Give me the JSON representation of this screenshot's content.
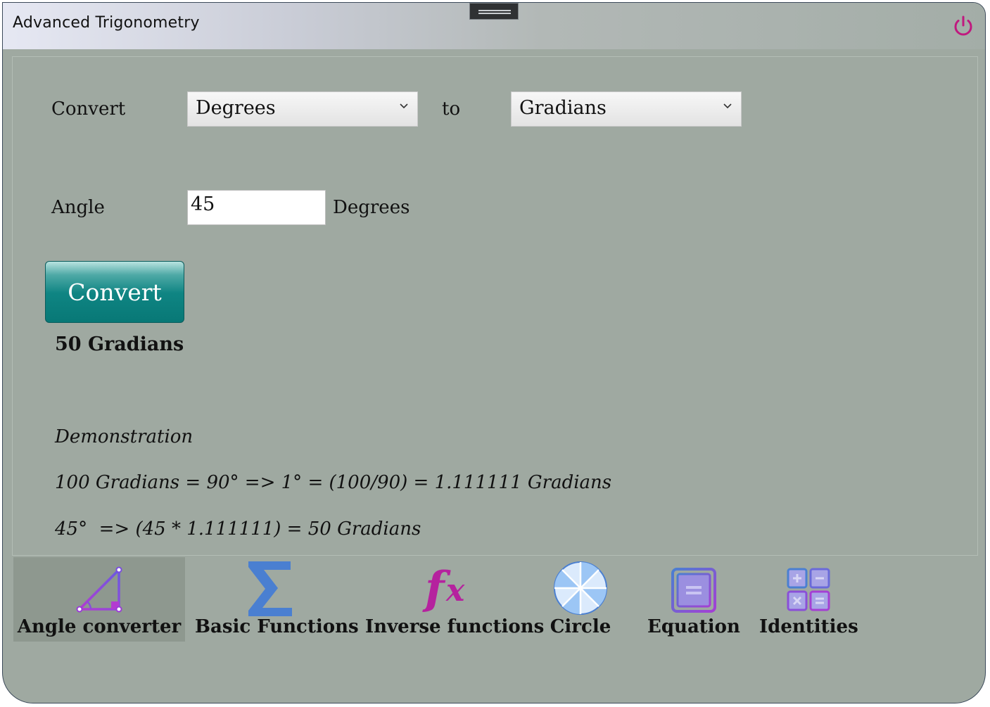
{
  "app": {
    "title": "Advanced Trigonometry"
  },
  "converter": {
    "convert_label": "Convert",
    "from_unit": "Degrees",
    "to_label": "to",
    "to_unit": "Gradians",
    "angle_label": "Angle",
    "angle_value": "45",
    "angle_unit": "Degrees",
    "convert_button": "Convert",
    "result": "50 Gradians"
  },
  "demonstration": {
    "heading": "Demonstration",
    "line1": "100 Gradians = 90° => 1° = (100/90) = 1.111111 Gradians",
    "line2": "45°  => (45 * 1.111111) = 50 Gradians"
  },
  "nav": [
    {
      "label": "Angle converter",
      "icon": "triangle-icon",
      "active": true
    },
    {
      "label": "Basic Functions",
      "icon": "sigma-icon"
    },
    {
      "label": "Inverse functions",
      "icon": "fx-icon"
    },
    {
      "label": "Circle",
      "icon": "circle-icon"
    },
    {
      "label": "Equation",
      "icon": "equation-icon"
    },
    {
      "label": "Identities",
      "icon": "calculator-icon"
    }
  ],
  "colors": {
    "background": "#9fa9a1",
    "button": "#0f8583",
    "power": "#c0197f",
    "icon_purple": "#8a3bd8",
    "icon_blue": "#4a7fd1",
    "icon_magenta": "#b5229e"
  }
}
